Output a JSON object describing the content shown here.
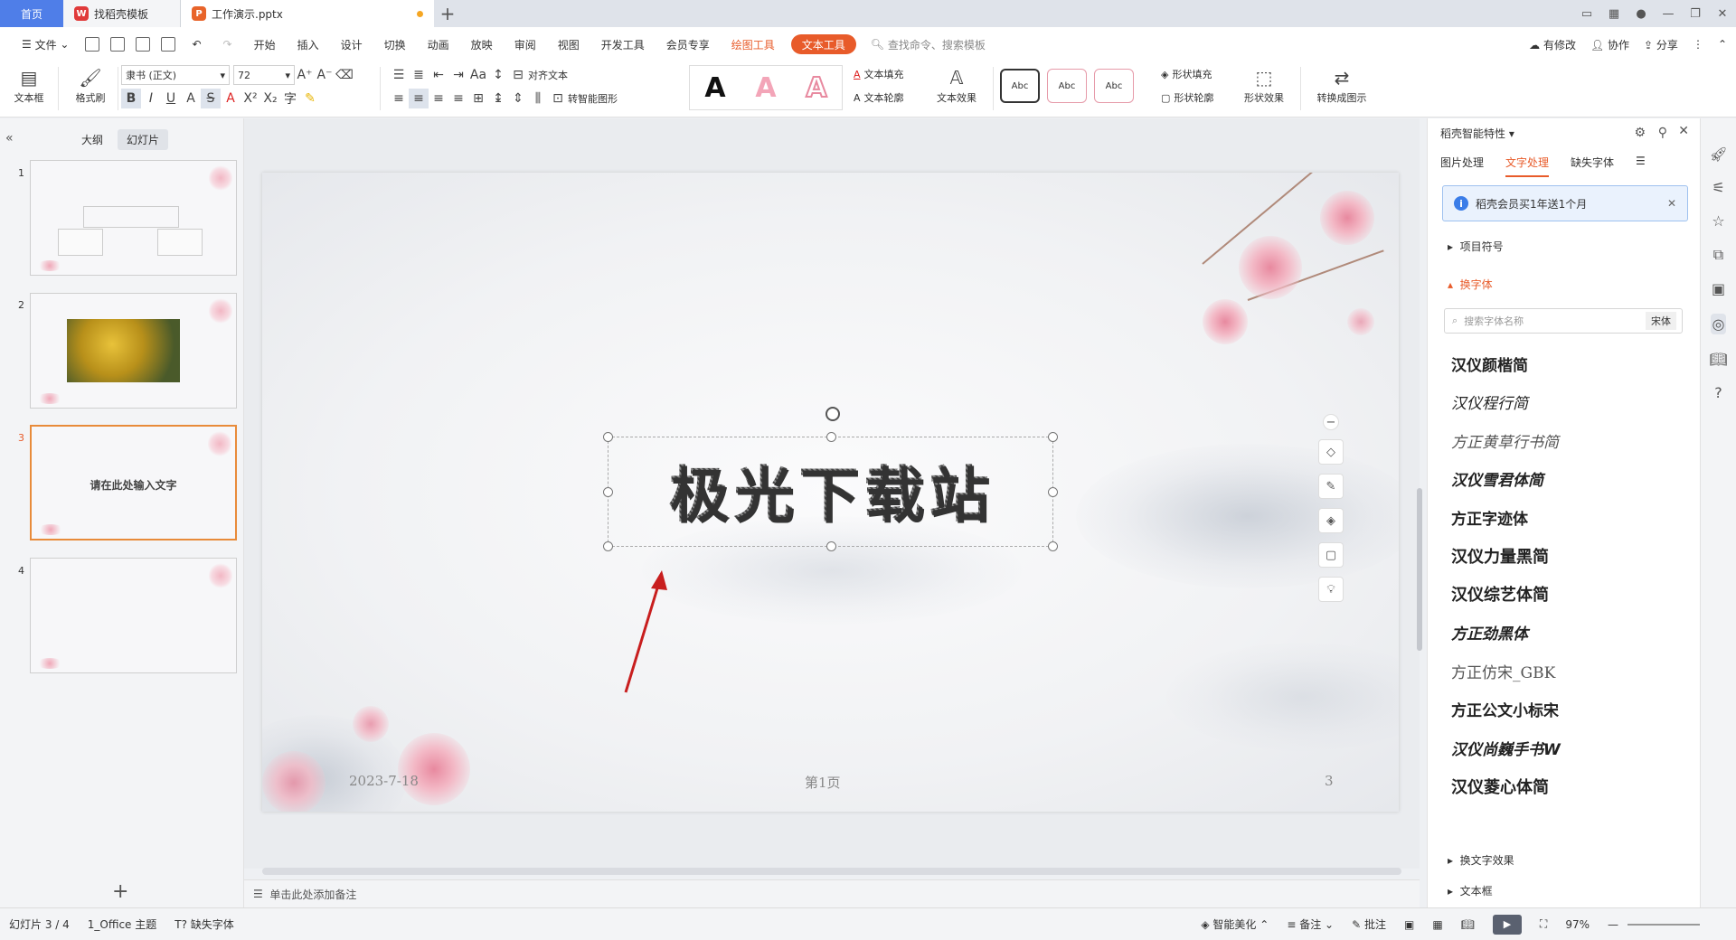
{
  "titlebar": {
    "tabs": [
      {
        "label": "首页"
      },
      {
        "label": "找稻壳模板"
      },
      {
        "label": "工作演示.pptx"
      }
    ]
  },
  "menubar": {
    "file": "文件",
    "items": [
      "开始",
      "插入",
      "设计",
      "切换",
      "动画",
      "放映",
      "审阅",
      "视图",
      "开发工具",
      "会员专享"
    ],
    "draw_tool": "绘图工具",
    "text_tool": "文本工具",
    "search_placeholder": "查找命令、搜索模板",
    "right": {
      "changes": "有修改",
      "collab": "协作",
      "share": "分享"
    }
  },
  "ribbon": {
    "textbox": "文本框",
    "format_brush": "格式刷",
    "font_name": "隶书 (正文)",
    "font_size": "72",
    "align_text": "对齐文本",
    "smart_shape": "转智能图形",
    "text_fill": "文本填充",
    "text_outline": "文本轮廓",
    "text_effect": "文本效果",
    "shape_fill": "形状填充",
    "shape_outline": "形状轮廓",
    "shape_effect": "形状效果",
    "convert": "转换成图示",
    "style_samples": [
      "Abc",
      "Abc",
      "Abc"
    ]
  },
  "leftpanel": {
    "tab_outline": "大纲",
    "tab_slides": "幻灯片",
    "slides": [
      {
        "num": "1"
      },
      {
        "num": "2"
      },
      {
        "num": "3",
        "text": "请在此处输入文字"
      },
      {
        "num": "4"
      }
    ]
  },
  "slide": {
    "title": "极光下载站",
    "date": "2023-7-18",
    "page": "第1页",
    "number": "3"
  },
  "notes": {
    "placeholder": "单击此处添加备注"
  },
  "rightpanel": {
    "header": "稻壳智能特性",
    "tabs": [
      "图片处理",
      "文字处理",
      "缺失字体"
    ],
    "promo": "稻壳会员买1年送1个月",
    "section_bullets": "项目符号",
    "section_font": "换字体",
    "font_search_placeholder": "搜索字体名称",
    "font_default": "宋体",
    "fonts": [
      "汉仪颜楷简",
      "汉仪程行简",
      "方正黄草行书简",
      "汉仪雪君体简",
      "方正字迹体",
      "汉仪力量黑简",
      "汉仪综艺体简",
      "方正劲黑体",
      "方正仿宋_GBK",
      "方正公文小标宋",
      "汉仪尚巍手书W",
      "汉仪菱心体简"
    ],
    "section_text_effect": "换文字效果",
    "section_textbox": "文本框"
  },
  "statusbar": {
    "slide_count": "幻灯片 3 / 4",
    "theme": "1_Office 主题",
    "missing_font": "缺失字体",
    "beautify": "智能美化",
    "notes": "备注",
    "comments": "批注",
    "zoom": "97%"
  },
  "colors": {
    "accent": "#e85b2a",
    "home_tab": "#4f7ee8"
  }
}
